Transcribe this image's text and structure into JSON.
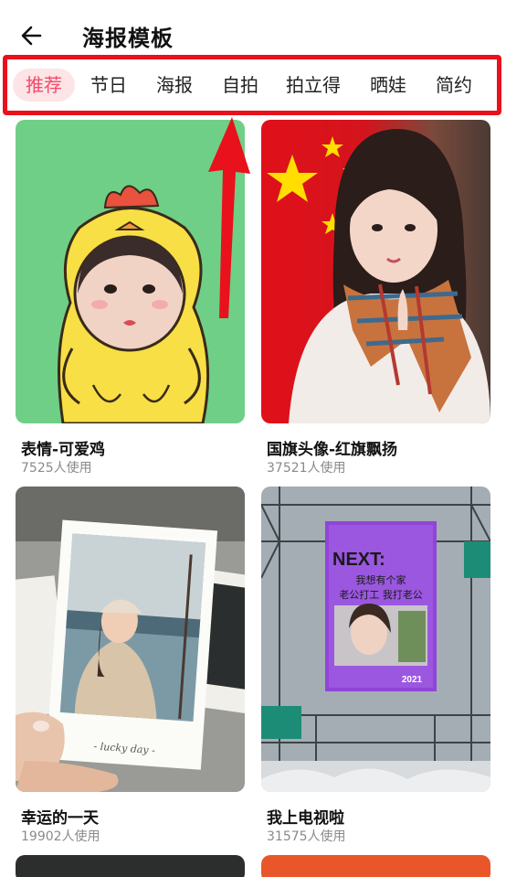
{
  "header": {
    "title": "海报模板",
    "back_icon": "arrow-left-icon"
  },
  "tabs": [
    {
      "label": "推荐",
      "active": true
    },
    {
      "label": "节日",
      "active": false
    },
    {
      "label": "海报",
      "active": false
    },
    {
      "label": "自拍",
      "active": false
    },
    {
      "label": "拍立得",
      "active": false
    },
    {
      "label": "晒娃",
      "active": false
    },
    {
      "label": "简约",
      "active": false
    }
  ],
  "colors": {
    "annotation_red": "#e8111c",
    "active_tab_bg": "#fde4e6",
    "active_tab_text": "#f24b6a",
    "muted_text": "#8a8a8a"
  },
  "templates": [
    {
      "name": "表情-可爱鸡",
      "usage": "7525人使用"
    },
    {
      "name": "国旗头像-红旗飘扬",
      "usage": "37521人使用"
    },
    {
      "name": "幸运的一天",
      "usage": "19902人使用",
      "photo_caption": "- lucky day -"
    },
    {
      "name": "我上电视啦",
      "usage": "31575人使用",
      "screen_title": "NEXT:",
      "screen_line1": "我想有个家",
      "screen_line2": "老公打工 我打老公",
      "screen_year": "2021"
    }
  ]
}
